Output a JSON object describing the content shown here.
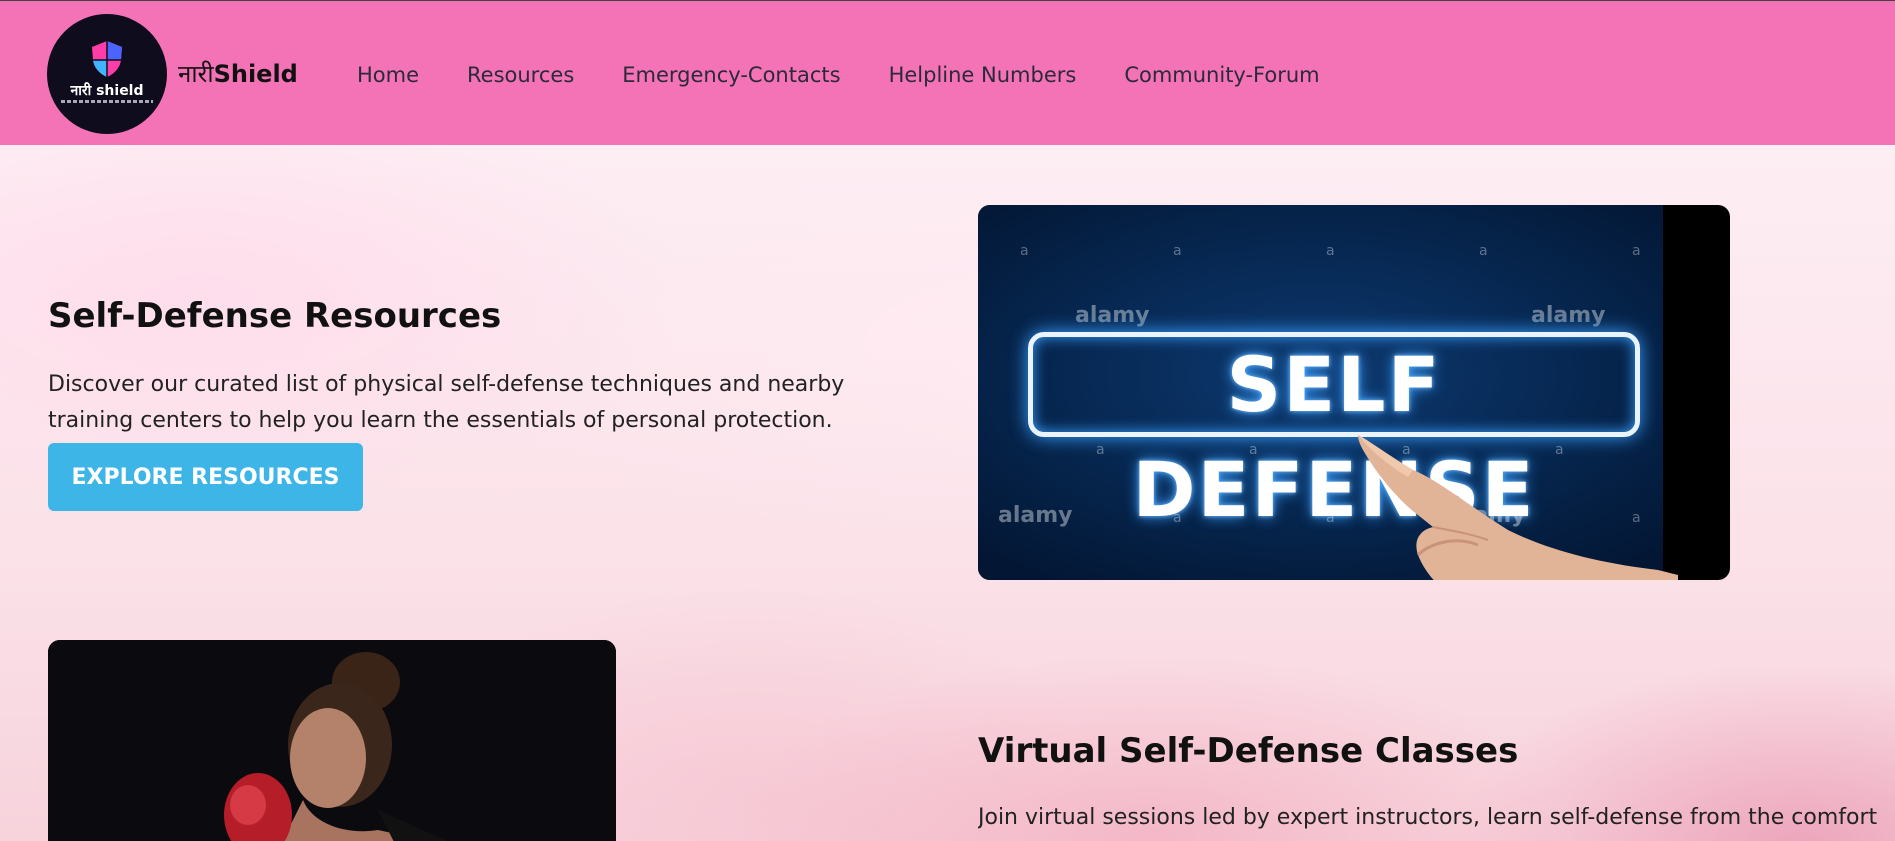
{
  "header": {
    "logo_text": "नारी shield",
    "brand_prefix": "नारी",
    "brand_suffix": "Shield",
    "nav": [
      {
        "label": "Home"
      },
      {
        "label": "Resources"
      },
      {
        "label": "Emergency-Contacts"
      },
      {
        "label": "Helpline Numbers"
      },
      {
        "label": "Community-Forum"
      }
    ]
  },
  "section_resources": {
    "title": "Self-Defense Resources",
    "description": "Discover our curated list of physical self-defense techniques and nearby training centers to help you learn the essentials of personal protection.",
    "button_label": "EXPLORE RESOURCES"
  },
  "image_self_defense": {
    "sign_text": "SELF DEFENSE",
    "watermark": "alamy",
    "watermark_small": "a"
  },
  "section_virtual": {
    "title": "Virtual Self-Defense Classes",
    "description": "Join virtual sessions led by expert instructors, learn self-defense from the comfort"
  },
  "colors": {
    "header_bg": "#f472b6",
    "button_bg": "#3db5e6",
    "logo_bg": "#0f0c1d"
  }
}
